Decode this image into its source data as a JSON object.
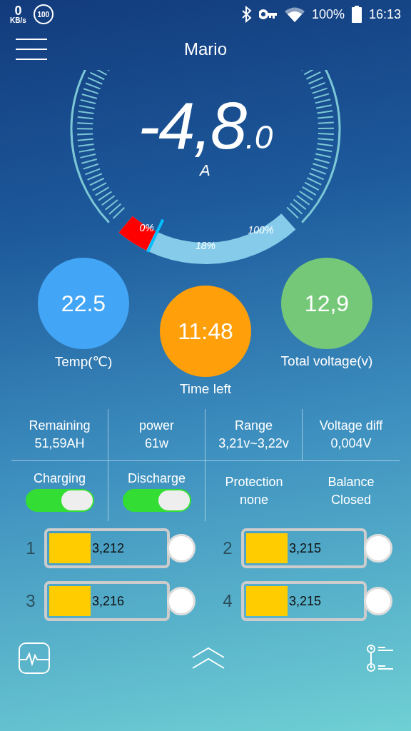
{
  "status_bar": {
    "net_speed": "0",
    "net_unit": "KB/s",
    "badge": "100",
    "battery_percent": "100%",
    "time": "16:13"
  },
  "header": {
    "title": "Mario"
  },
  "gauge": {
    "current": "-4,8",
    "decimal": ".0",
    "unit": "A",
    "start_label": "0%",
    "reading": "18%",
    "end_label": "100%"
  },
  "stats": [
    {
      "value": "22.5",
      "label": "Temp(℃)",
      "color": "#42a5f5"
    },
    {
      "value": "11:48",
      "label": "Time left",
      "color": "#ff9f0a"
    },
    {
      "value": "12,9",
      "label": "Total voltage(v)",
      "color": "#74c877"
    }
  ],
  "info": [
    {
      "label": "Remaining",
      "value": "51,59AH"
    },
    {
      "label": "power",
      "value": "61w"
    },
    {
      "label": "Range",
      "value": "3,21v~3,22v"
    },
    {
      "label": "Voltage diff",
      "value": "0,004V"
    }
  ],
  "controls": [
    {
      "kind": "toggle",
      "label": "Charging",
      "on": true
    },
    {
      "kind": "toggle",
      "label": "Discharge",
      "on": true
    },
    {
      "kind": "text",
      "label": "Protection",
      "value": "none"
    },
    {
      "kind": "text",
      "label": "Balance",
      "value": "Closed"
    }
  ],
  "cells": [
    {
      "index": "1",
      "value": "3,212"
    },
    {
      "index": "2",
      "value": "3,215"
    },
    {
      "index": "3",
      "value": "3,216"
    },
    {
      "index": "4",
      "value": "3,215"
    }
  ]
}
